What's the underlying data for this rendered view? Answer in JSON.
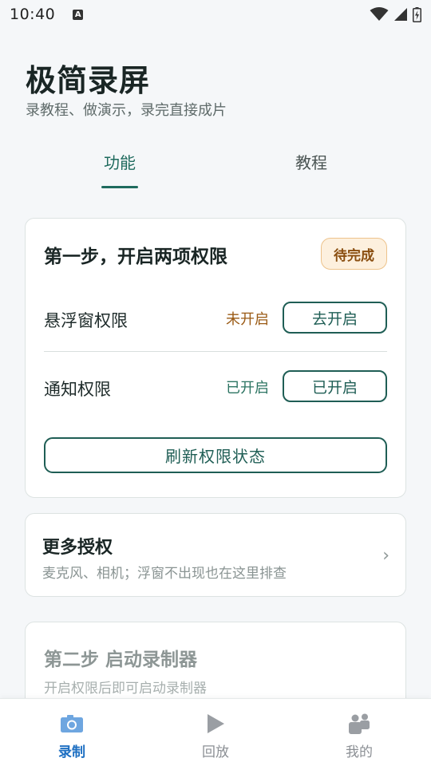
{
  "status_bar": {
    "time": "10:40",
    "notification_icon": "a-icon",
    "icons": [
      "wifi-icon",
      "signal-icon",
      "battery-icon"
    ]
  },
  "header": {
    "title": "极简录屏",
    "subtitle": "录教程、做演示，录完直接成片"
  },
  "tabs": [
    {
      "label": "功能",
      "active": true
    },
    {
      "label": "教程",
      "active": false
    }
  ],
  "step1": {
    "title": "第一步，开启两项权限",
    "badge": "待完成",
    "permissions": [
      {
        "label": "悬浮窗权限",
        "status": "未开启",
        "button": "去开启"
      },
      {
        "label": "通知权限",
        "status": "已开启",
        "button": "已开启"
      }
    ],
    "refresh_button": "刷新权限状态"
  },
  "more_auth": {
    "title": "更多授权",
    "description": "麦克风、相机；浮窗不出现也在这里排查",
    "chevron": "›"
  },
  "step2": {
    "title": "第二步 启动录制器",
    "description": "开启权限后即可启动录制器"
  },
  "bottom_nav": [
    {
      "label": "录制",
      "icon": "camera-icon",
      "active": true
    },
    {
      "label": "回放",
      "icon": "play-icon",
      "active": false
    },
    {
      "label": "我的",
      "icon": "people-icon",
      "active": false
    }
  ],
  "colors": {
    "primary": "#1f5e55",
    "tab_active": "#1f6b5e",
    "nav_active": "#1d6fc2",
    "badge_bg": "#fdf0de",
    "badge_text": "#8a4e10",
    "status_off": "#9a5a14",
    "status_on": "#2c7462"
  }
}
